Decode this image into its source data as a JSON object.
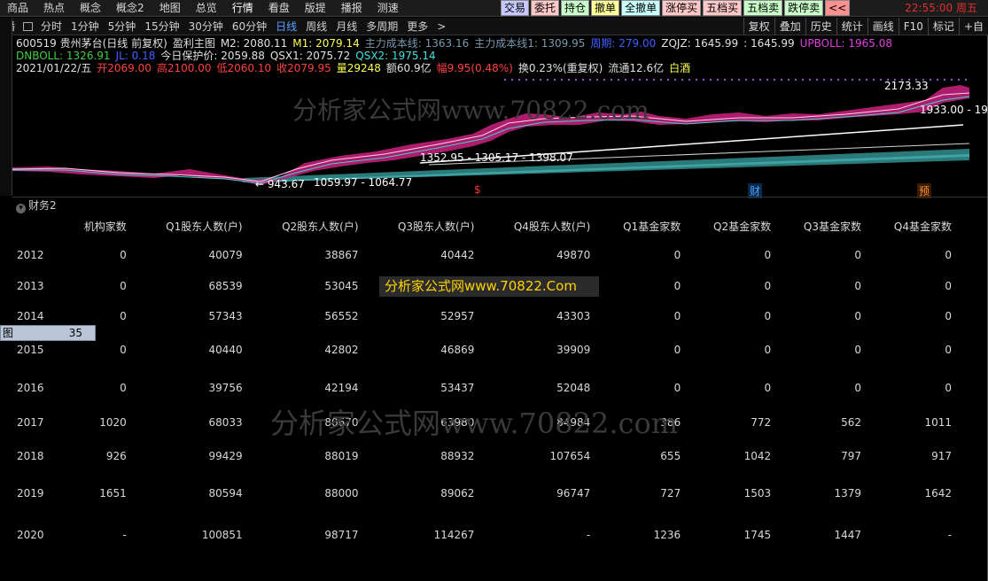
{
  "menu": {
    "items": [
      "商品",
      "热点",
      "概念",
      "概念2",
      "地图",
      "总览",
      "行情",
      "看盘",
      "版提",
      "播报",
      "测速"
    ],
    "trade_buttons": [
      {
        "label": "交易",
        "color": "#c8c8ff"
      },
      {
        "label": "委托",
        "color": "#ffc8c8"
      },
      {
        "label": "持仓",
        "color": "#c8ffc8"
      },
      {
        "label": "撤单",
        "color": "#ffff98"
      },
      {
        "label": "全撤单",
        "color": "#c8ffff"
      },
      {
        "label": "涨停买",
        "color": "#ffc8c8"
      },
      {
        "label": "五档买",
        "color": "#ffc8c8"
      },
      {
        "label": "五档卖",
        "color": "#c8ffc8"
      },
      {
        "label": "跌停卖",
        "color": "#c8ffc8"
      },
      {
        "label": "<<",
        "color": "#ff9090"
      }
    ],
    "clock": "22:55:00  周五"
  },
  "toolbar": {
    "left_label": "播",
    "periods": [
      "分时",
      "1分钟",
      "5分钟",
      "15分钟",
      "30分钟",
      "60分钟",
      "日线",
      "周线",
      "月线",
      "多周期",
      "更多"
    ],
    "active": "日线",
    "more_arrow": ">",
    "right": [
      "复权",
      "叠加",
      "历史",
      "统计",
      "画线",
      "F10",
      "标记",
      "+自"
    ]
  },
  "chart": {
    "line1": [
      {
        "t": "600519 贵州茅台(日线 前复权)",
        "c": "#e0e0e0"
      },
      {
        "t": "盈利主图",
        "c": "#e0e0e0"
      },
      {
        "t": "M2: 2080.11",
        "c": "#e0e0e0"
      },
      {
        "t": "M1: 2079.14",
        "c": "#ffff50"
      },
      {
        "t": "主力成本线: 1363.16",
        "c": "#7a9ab0"
      },
      {
        "t": "主力成本线1: 1309.95",
        "c": "#7a9ab0"
      },
      {
        "t": "周期: 279.00",
        "c": "#4060ff"
      },
      {
        "t": "ZQJZ: 1645.99",
        "c": "#e0e0e0"
      },
      {
        "t": ": 1645.99",
        "c": "#e0e0e0"
      },
      {
        "t": "UPBOLL: 1965.08",
        "c": "#e040e0"
      }
    ],
    "line2": [
      {
        "t": "DNBOLL: 1326.91",
        "c": "#40d040"
      },
      {
        "t": "JL: 0.18",
        "c": "#4060ff"
      },
      {
        "t": "今日保护价: 2059.88",
        "c": "#e0e0e0"
      },
      {
        "t": "QSX1: 2075.72",
        "c": "#e0e0e0"
      },
      {
        "t": "QSX2: 1975.14",
        "c": "#40e0e0"
      }
    ],
    "line3": [
      {
        "t": "2021/01/22/五",
        "c": "#e0e0e0"
      },
      {
        "t": "开2069.00",
        "c": "#ff4040"
      },
      {
        "t": "高2100.00",
        "c": "#ff4040"
      },
      {
        "t": "低2060.10",
        "c": "#ff4040"
      },
      {
        "t": "收2079.95",
        "c": "#ff4040"
      },
      {
        "t": "量29248",
        "c": "#ffff50"
      },
      {
        "t": "额60.9亿",
        "c": "#e0e0e0"
      },
      {
        "t": "幅9.95(0.48%)",
        "c": "#ff4040"
      },
      {
        "t": "换0.23%(重复权)",
        "c": "#e0e0e0"
      },
      {
        "t": "流通12.6亿",
        "c": "#e0e0e0"
      },
      {
        "t": "白酒",
        "c": "#ffff50"
      }
    ],
    "labels": {
      "high": "2173.33",
      "right_val": "1933.00 - 19",
      "range1": "1352.95 - 1305.17 - 1398.07",
      "low_pair": "← 943.67",
      "range2": "1059.97 - 1064.77",
      "marker_s": "$",
      "marker_cai": "财",
      "marker_yu": "预"
    },
    "watermark": "分析家公式网www.70822.com"
  },
  "finance": {
    "title": "财务2",
    "headers": [
      "",
      "机构家数",
      "Q1股东人数(户)",
      "Q2股东人数(户)",
      "Q3股东人数(户)",
      "Q4股东人数(户)",
      "Q1基金家数",
      "Q2基金家数",
      "Q3基金家数",
      "Q4基金家数"
    ],
    "rows": [
      [
        "2012",
        "0",
        "40079",
        "38867",
        "40442",
        "49870",
        "0",
        "0",
        "0",
        "0"
      ],
      [
        "2013",
        "0",
        "68539",
        "53045",
        "",
        "",
        "0",
        "0",
        "0",
        "0"
      ],
      [
        "2014",
        "0",
        "57343",
        "56552",
        "52957",
        "43303",
        "0",
        "0",
        "0",
        "0"
      ],
      [
        "2015",
        "0",
        "40440",
        "42802",
        "46869",
        "39909",
        "0",
        "0",
        "0",
        "0"
      ],
      [
        "2016",
        "0",
        "39756",
        "42194",
        "53437",
        "52048",
        "0",
        "0",
        "0",
        "0"
      ],
      [
        "2017",
        "1020",
        "68033",
        "80670",
        "63980",
        "84984",
        "386",
        "772",
        "562",
        "1011"
      ],
      [
        "2018",
        "926",
        "99429",
        "88019",
        "88932",
        "107654",
        "655",
        "1042",
        "797",
        "917"
      ],
      [
        "2019",
        "1651",
        "80594",
        "88000",
        "89062",
        "96747",
        "727",
        "1503",
        "1379",
        "1642"
      ],
      [
        "2020",
        "-",
        "100851",
        "98717",
        "114267",
        "-",
        "1236",
        "1745",
        "1447",
        "-"
      ]
    ],
    "side_label_a": "图",
    "side_label_b": "35",
    "ad": "分析家公式网www.70822.Com",
    "watermark": "分析家公式网www.70822.com"
  }
}
